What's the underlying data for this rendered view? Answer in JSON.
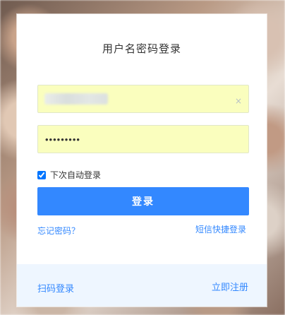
{
  "login_card": {
    "title": "用户名密码登录",
    "username_field": {
      "value": "",
      "placeholder": ""
    },
    "password_field": {
      "value": "•••••••••"
    },
    "remember_label": "下次自动登录",
    "login_button": "登录",
    "forgot_password_link": "忘记密码？",
    "sms_login_link": "短信快捷登录",
    "scan_login_link": "扫码登录",
    "register_link": "立即注册",
    "clear_glyph": "×"
  },
  "colors": {
    "primary": "#3388ff",
    "input_bg": "#fafebe",
    "footer_bg": "#eef6ff"
  }
}
